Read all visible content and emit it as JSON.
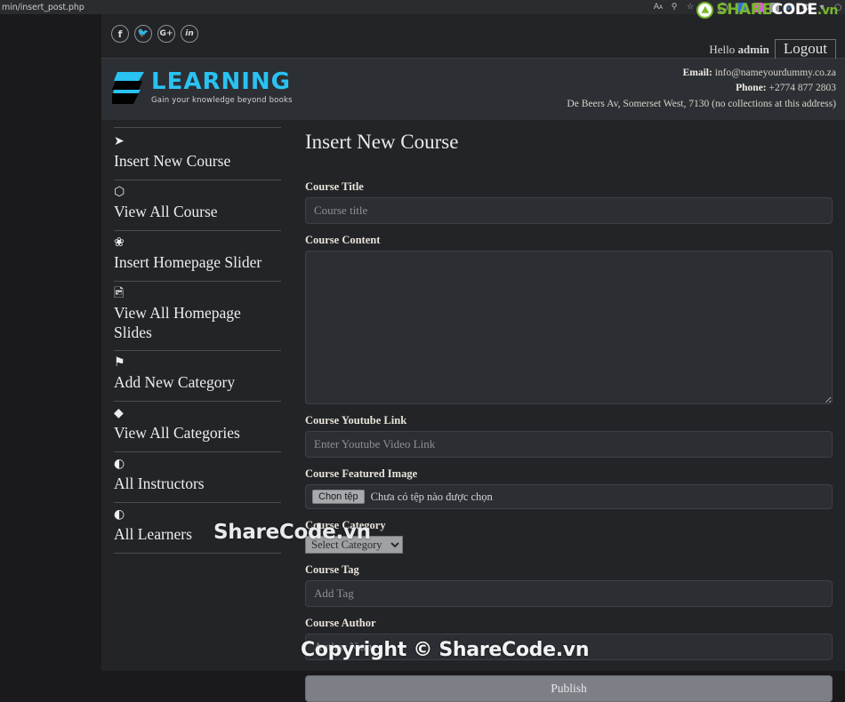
{
  "browser": {
    "url": "min/insert_post.php",
    "toolbar_icons": [
      {
        "name": "reader-font-icon",
        "glyph": "ᴀA"
      },
      {
        "name": "search-icon",
        "glyph": "⌕"
      },
      {
        "name": "bookmark-star-icon",
        "glyph": "☆"
      },
      {
        "name": "shield-green-icon",
        "glyph": ""
      },
      {
        "name": "ghostery-icon",
        "glyph": "●"
      },
      {
        "name": "extension-blue-icon",
        "glyph": ""
      },
      {
        "name": "extension-pink-icon",
        "glyph": ""
      },
      {
        "name": "screenshot-camera-icon",
        "glyph": "▣"
      },
      {
        "name": "pen-edit-icon",
        "glyph": "✐"
      },
      {
        "name": "gear-icon",
        "glyph": "⚙"
      },
      {
        "name": "chevron-down-icon",
        "glyph": "▼"
      },
      {
        "name": "profile-icon",
        "glyph": "◍"
      }
    ]
  },
  "watermark": {
    "brand_share": "SHARE",
    "brand_code": "CODE",
    "brand_vn": ".vn",
    "middle_text": "ShareCode.vn",
    "copyright_text": "Copyright © ShareCode.vn",
    "green": "#76b82a"
  },
  "topbar": {
    "socials": [
      {
        "name": "facebook-icon",
        "glyph": "f"
      },
      {
        "name": "twitter-icon",
        "glyph": "✈"
      },
      {
        "name": "google-plus-icon",
        "glyph": "G+"
      },
      {
        "name": "linkedin-icon",
        "glyph": "in"
      }
    ],
    "hello_prefix": "Hello ",
    "hello_user": "admin",
    "logout_label": "Logout"
  },
  "brand": {
    "logo_word": "LEARNING",
    "logo_tagline": "Gain your knowledge beyond books",
    "logo_color": "#29c2f2",
    "email_label": "Email:",
    "email_value": " info@nameyourdummy.co.za",
    "phone_label": "Phone:",
    "phone_value": " +2774 877 2803",
    "address": "De Beers Av, Somerset West, 7130 (no collections at this address)"
  },
  "sidebar": {
    "items": [
      {
        "label": "Insert New Course",
        "icon": "paper-plane-icon",
        "glyph": "➤"
      },
      {
        "label": "View All Course",
        "icon": "cube-icon",
        "glyph": "⬡"
      },
      {
        "label": "Insert Homepage Slider",
        "icon": "leaf-icon",
        "glyph": "❀"
      },
      {
        "label": "View All Homepage Slides",
        "icon": "image-file-icon",
        "glyph": "ὛB"
      },
      {
        "label": "Add New Category",
        "icon": "bookmark-icon",
        "glyph": "⚑"
      },
      {
        "label": "View All Categories",
        "icon": "gem-icon",
        "glyph": "♦"
      },
      {
        "label": "All Instructors",
        "icon": "adjust-circle-icon",
        "glyph": "◐"
      },
      {
        "label": "All Learners",
        "icon": "adjust-circle-icon",
        "glyph": "◐"
      }
    ]
  },
  "main": {
    "title": "Insert New Course",
    "fields": {
      "title_label": "Course Title",
      "title_placeholder": "Course title",
      "title_value": "",
      "content_label": "Course Content",
      "content_placeholder": "",
      "content_value": "",
      "youtube_label": "Course Youtube Link",
      "youtube_placeholder": "Enter Youtube Video Link",
      "youtube_value": "",
      "image_label": "Course Featured Image",
      "file_button_label": "Chọn tệp",
      "file_status": "Chưa có tệp nào được chọn",
      "category_label": "Course Category",
      "category_selected": "Select Category",
      "category_options": [
        "Select Category"
      ],
      "tag_label": "Course Tag",
      "tag_placeholder": "Add Tag",
      "tag_value": "",
      "author_label": "Course Author",
      "author_placeholder": "Author Name",
      "author_value": "",
      "publish_label": "Publish"
    }
  }
}
